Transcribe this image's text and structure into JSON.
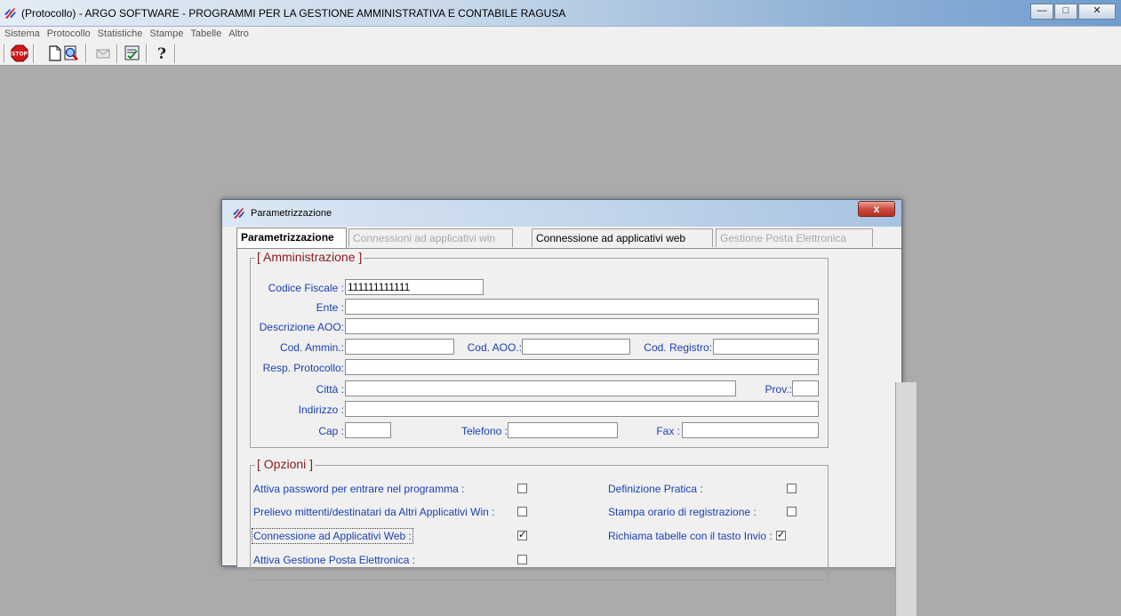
{
  "window": {
    "title": "(Protocollo) - ARGO SOFTWARE - PROGRAMMI PER LA GESTIONE AMMINISTRATIVA E CONTABILE RAGUSA",
    "controls": [
      "minimize",
      "maximize",
      "close"
    ]
  },
  "menubar": {
    "items": [
      "Sistema",
      "Protocollo",
      "Statistiche",
      "Stampe",
      "Tabelle",
      "Altro"
    ]
  },
  "toolbar": {
    "icons": [
      "stop-icon",
      "new-document-icon",
      "search-document-icon",
      "mail-icon",
      "edit-form-icon",
      "help-icon"
    ]
  },
  "dialog": {
    "title": "Parametrizzazione",
    "close_label": "x",
    "tabs": [
      {
        "label": "Parametrizzazione",
        "state": "active"
      },
      {
        "label": "Connessioni ad applicativi win",
        "state": "disabled"
      },
      {
        "label": "Connessione ad applicativi web",
        "state": "normal"
      },
      {
        "label": "Gestione Posta Elettronica",
        "state": "disabled"
      }
    ],
    "amministrazione": {
      "legend": "[ Amministrazione ]",
      "codice_fiscale": {
        "label": "Codice Fiscale :",
        "value": "111111111111"
      },
      "ente": {
        "label": "Ente :",
        "value": ""
      },
      "descrizione_aoo": {
        "label": "Descrizione AOO:",
        "value": ""
      },
      "cod_ammin": {
        "label": "Cod. Ammin.:",
        "value": ""
      },
      "cod_aoo": {
        "label": "Cod. AOO.:",
        "value": ""
      },
      "cod_registro": {
        "label": "Cod. Registro:",
        "value": ""
      },
      "resp_protocollo": {
        "label": "Resp. Protocollo:",
        "value": ""
      },
      "citta": {
        "label": "Città :",
        "value": ""
      },
      "prov": {
        "label": "Prov.:",
        "value": ""
      },
      "indirizzo": {
        "label": "Indirizzo :",
        "value": ""
      },
      "cap": {
        "label": "Cap :",
        "value": ""
      },
      "telefono": {
        "label": "Telefono :",
        "value": ""
      },
      "fax": {
        "label": "Fax :",
        "value": ""
      }
    },
    "opzioni": {
      "legend": "[ Opzioni ]",
      "items": [
        {
          "label": "Attiva password per entrare nel programma :",
          "checked": false
        },
        {
          "label": "Definizione Pratica :",
          "checked": false
        },
        {
          "label": "Prelievo mittenti/destinatari da Altri Applicativi Win :",
          "checked": false
        },
        {
          "label": "Stampa orario di registrazione :",
          "checked": false
        },
        {
          "label": "Connessione ad Applicativi Web :",
          "checked": true
        },
        {
          "label": "Richiama tabelle con il tasto Invio :",
          "checked": true
        },
        {
          "label": "Attiva Gestione Posta Elettronica :",
          "checked": false
        }
      ]
    }
  }
}
